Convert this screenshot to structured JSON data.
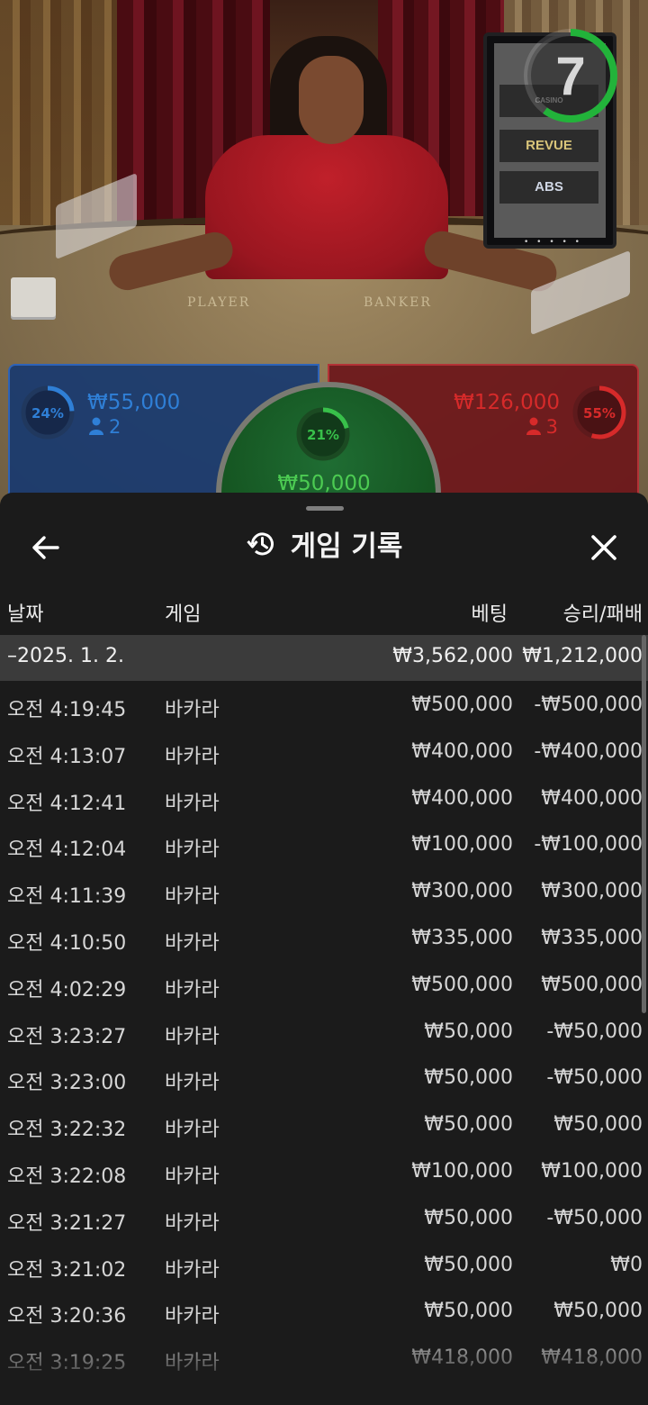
{
  "video": {
    "timer_value": "7",
    "timer_fraction": 0.6,
    "felt_player_label": "PLAYER",
    "felt_banker_label": "BANKER",
    "monitor_casino": "CASINO",
    "monitor_revue": "REVUE",
    "monitor_abs": "ABS",
    "monitor_dots": "• • • • •"
  },
  "bets": {
    "player": {
      "percent": "24%",
      "fraction": 0.24,
      "amount": "₩55,000",
      "count": "2",
      "color": "#2f7fd6"
    },
    "tie": {
      "percent": "21%",
      "fraction": 0.21,
      "amount": "₩50,000",
      "color": "#38c04a"
    },
    "banker": {
      "percent": "55%",
      "fraction": 0.55,
      "amount": "₩126,000",
      "count": "3",
      "color": "#d62a2a"
    }
  },
  "sheet": {
    "title": "게임 기록",
    "icons": {
      "back": "arrow-left-icon",
      "title": "history-icon",
      "close": "close-icon"
    },
    "columns": {
      "date": "날짜",
      "game": "게임",
      "bet": "베팅",
      "win": "승리/패배"
    },
    "summary": {
      "date": "–2025. 1. 2.",
      "bet": "₩3,562,000",
      "win": "₩1,212,000"
    },
    "rows": [
      {
        "time": "오전 4:19:45",
        "game": "바카라",
        "bet": "₩500,000",
        "win": "-₩500,000"
      },
      {
        "time": "오전 4:13:07",
        "game": "바카라",
        "bet": "₩400,000",
        "win": "-₩400,000"
      },
      {
        "time": "오전 4:12:41",
        "game": "바카라",
        "bet": "₩400,000",
        "win": "₩400,000"
      },
      {
        "time": "오전 4:12:04",
        "game": "바카라",
        "bet": "₩100,000",
        "win": "-₩100,000"
      },
      {
        "time": "오전 4:11:39",
        "game": "바카라",
        "bet": "₩300,000",
        "win": "₩300,000"
      },
      {
        "time": "오전 4:10:50",
        "game": "바카라",
        "bet": "₩335,000",
        "win": "₩335,000"
      },
      {
        "time": "오전 4:02:29",
        "game": "바카라",
        "bet": "₩500,000",
        "win": "₩500,000"
      },
      {
        "time": "오전 3:23:27",
        "game": "바카라",
        "bet": "₩50,000",
        "win": "-₩50,000"
      },
      {
        "time": "오전 3:23:00",
        "game": "바카라",
        "bet": "₩50,000",
        "win": "-₩50,000"
      },
      {
        "time": "오전 3:22:32",
        "game": "바카라",
        "bet": "₩50,000",
        "win": "₩50,000"
      },
      {
        "time": "오전 3:22:08",
        "game": "바카라",
        "bet": "₩100,000",
        "win": "₩100,000"
      },
      {
        "time": "오전 3:21:27",
        "game": "바카라",
        "bet": "₩50,000",
        "win": "-₩50,000"
      },
      {
        "time": "오전 3:21:02",
        "game": "바카라",
        "bet": "₩50,000",
        "win": "₩0"
      },
      {
        "time": "오전 3:20:36",
        "game": "바카라",
        "bet": "₩50,000",
        "win": "₩50,000"
      },
      {
        "time": "오전 3:19:25",
        "game": "바카라",
        "bet": "₩418,000",
        "win": "₩418,000"
      }
    ]
  }
}
